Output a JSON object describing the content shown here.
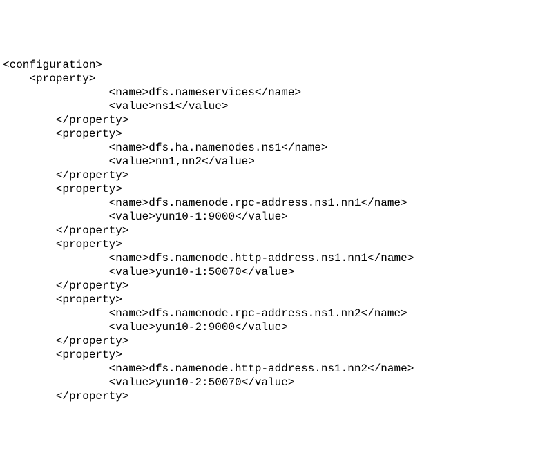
{
  "config": {
    "root_open": "<configuration>",
    "property_open": "<property>",
    "property_close": "</property>",
    "name_open": "<name>",
    "name_close": "</name>",
    "value_open": "<value>",
    "value_close": "</value>",
    "properties": [
      {
        "name": "dfs.nameservices",
        "value": "ns1"
      },
      {
        "name": "dfs.ha.namenodes.ns1",
        "value": "nn1,nn2"
      },
      {
        "name": "dfs.namenode.rpc-address.ns1.nn1",
        "value": "yun10-1:9000"
      },
      {
        "name": "dfs.namenode.http-address.ns1.nn1",
        "value": "yun10-1:50070"
      },
      {
        "name": "dfs.namenode.rpc-address.ns1.nn2",
        "value": "yun10-2:9000"
      },
      {
        "name": "dfs.namenode.http-address.ns1.nn2",
        "value": "yun10-2:50070"
      }
    ]
  },
  "indent": {
    "root": "",
    "prop": "    ",
    "prop_close": "        ",
    "tag": "                "
  }
}
